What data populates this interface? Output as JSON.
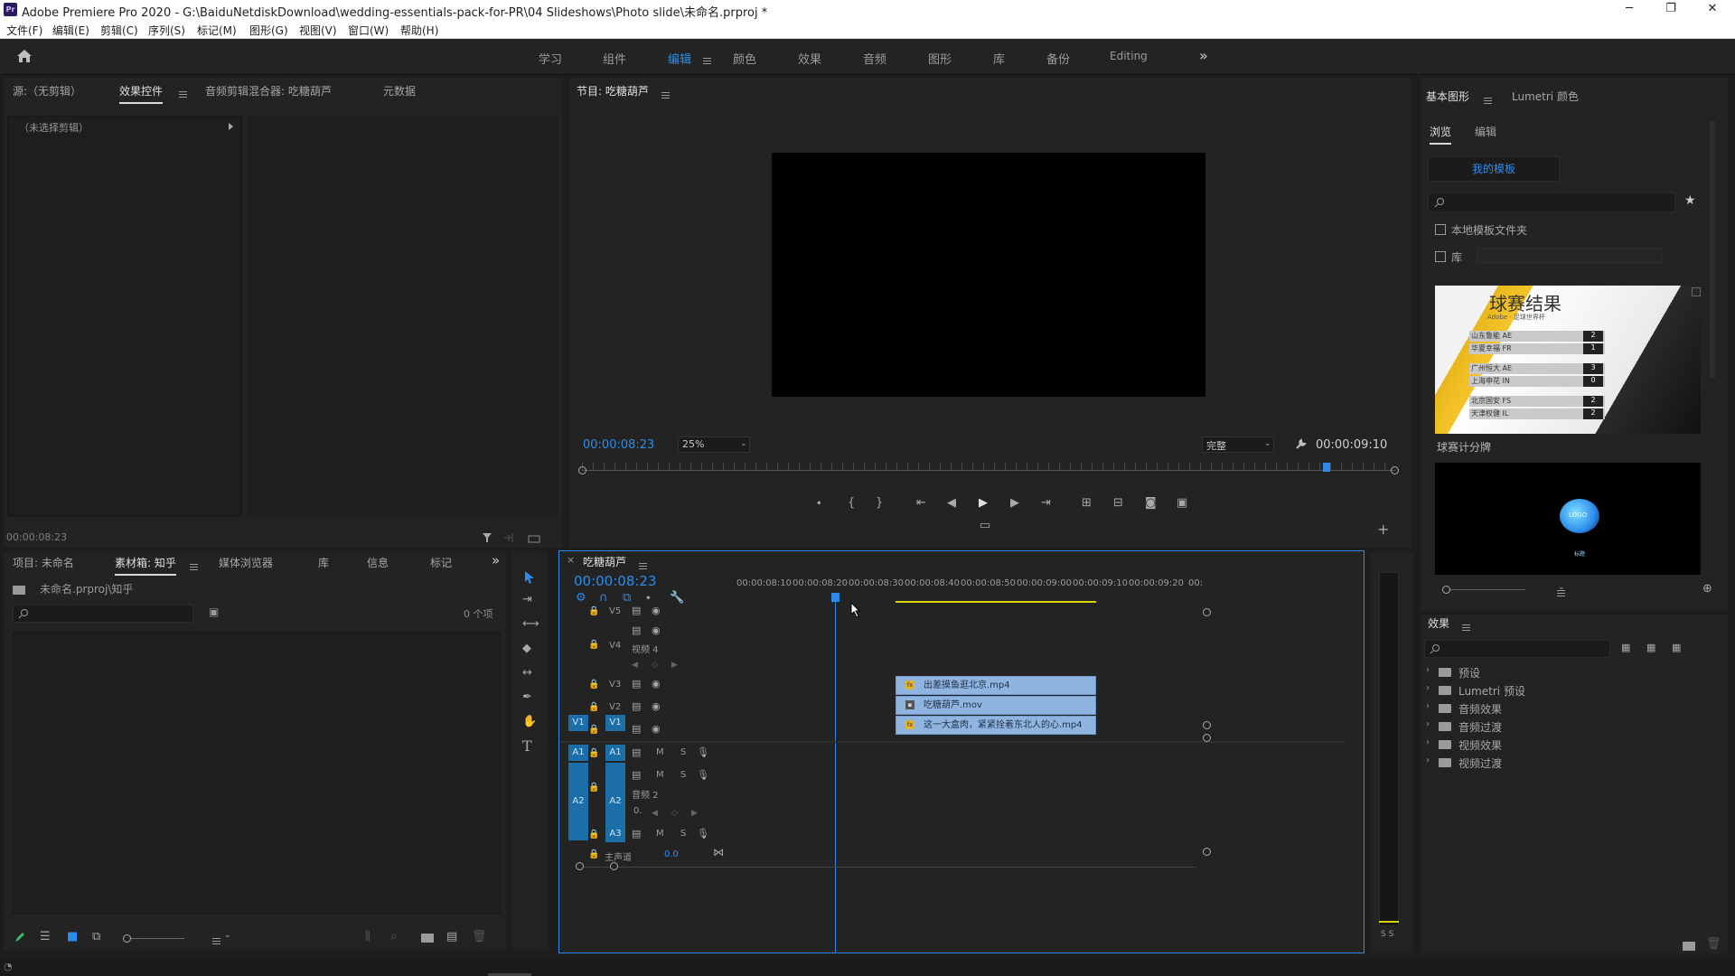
{
  "window": {
    "app_badge": "Pr",
    "title": "Adobe Premiere Pro 2020 - G:\\BaiduNetdiskDownload\\wedding-essentials-pack-for-PR\\04 Slideshows\\Photo slide\\未命名.prproj *",
    "min": "─",
    "max": "❐",
    "close": "✕"
  },
  "menu": [
    "文件(F)",
    "编辑(E)",
    "剪辑(C)",
    "序列(S)",
    "标记(M)",
    "图形(G)",
    "视图(V)",
    "窗口(W)",
    "帮助(H)"
  ],
  "workspaces": [
    "学习",
    "组件",
    "编辑",
    "颜色",
    "效果",
    "音频",
    "图形",
    "库",
    "备份",
    "Editing"
  ],
  "workspaces_more": "»",
  "source_panel": {
    "tabs": [
      "源:（无剪辑）",
      "效果控件",
      "音频剪辑混合器: 吃糖葫芦",
      "元数据"
    ],
    "no_clip": "（未选择剪辑）",
    "timecode": "00:00:08:23"
  },
  "program": {
    "title": "节目: 吃糖葫芦",
    "timecode": "00:00:08:23",
    "zoom": "25%",
    "quality": "完整",
    "duration": "00:00:09:10"
  },
  "project_panel": {
    "tabs": [
      "项目: 未命名",
      "素材箱: 知乎",
      "媒体浏览器",
      "库",
      "信息",
      "标记"
    ],
    "path": "未命名.prproj\\知乎",
    "count": "0 个项"
  },
  "timeline": {
    "name": "吃糖葫芦",
    "timecode": "00:00:08:23",
    "ruler": [
      "00:00:08:10",
      "00:00:08:20",
      "00:00:08:30",
      "00:00:08:40",
      "00:00:08:50",
      "00:00:09:00",
      "00:00:09:10",
      "00:00:09:20",
      "00:"
    ],
    "tracks": {
      "v5": "V5",
      "v4": "V4",
      "v4_name": "视频 4",
      "v3": "V3",
      "v2": "V2",
      "v1": "V1",
      "a1": "A1",
      "a2": "A2",
      "a2_name": "音频 2",
      "a3": "A3",
      "master": "主声道",
      "master_val": "0.0",
      "m": "M",
      "s": "S",
      "zero": "0."
    },
    "clips": [
      "出差摸鱼逛北京.mp4",
      "吃糖葫芦.mov",
      "这一大盒肉，紧紧拴着东北人的心.mp4"
    ],
    "meter_ss": "S S"
  },
  "essential_graphics": {
    "tabs": [
      "基本图形",
      "Lumetri 颜色"
    ],
    "subtabs": [
      "浏览",
      "编辑"
    ],
    "templates_btn": "我的模板",
    "local_folder": "本地模板文件夹",
    "library": "库",
    "card1": {
      "label": "球赛计分牌",
      "heading": "球赛结果",
      "sub": "Adobe · 足球世界杯",
      "rows": [
        {
          "name": "山东鲁能 AE",
          "score": "2"
        },
        {
          "name": "华夏幸福 FR",
          "score": "1"
        },
        {
          "name": "广州恒大 AE",
          "score": "3"
        },
        {
          "name": "上海申花 IN",
          "score": "0"
        },
        {
          "name": "北京国安 FS",
          "score": "2"
        },
        {
          "name": "天津权健 IL",
          "score": "2"
        }
      ]
    },
    "card2": {
      "bubble": "LOGO",
      "caption": "标题"
    }
  },
  "effects": {
    "title": "效果",
    "items": [
      "预设",
      "Lumetri 预设",
      "音频效果",
      "音频过渡",
      "视频效果",
      "视频过渡"
    ]
  }
}
